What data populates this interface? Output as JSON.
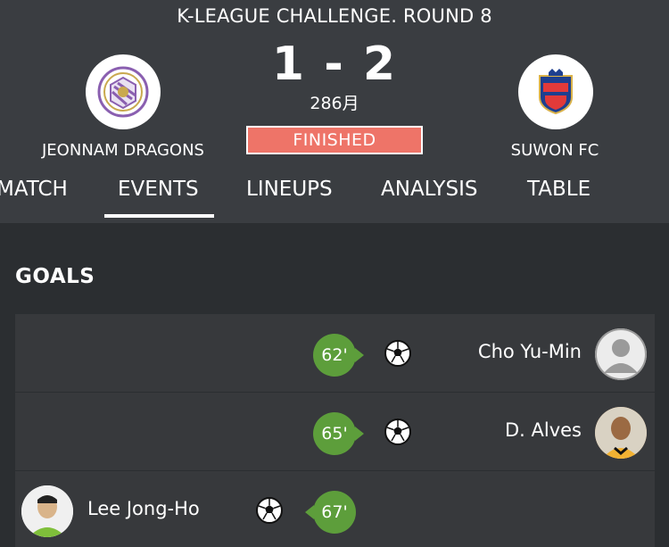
{
  "match": {
    "round_title": "K-LEAGUE CHALLENGE. ROUND 8",
    "score": "1 - 2",
    "score_sub": "286月",
    "status": "FINISHED"
  },
  "home_team": {
    "name": "JEONNAM DRAGONS",
    "logo_icon": "jeonnam-dragons-crest-icon"
  },
  "away_team": {
    "name": "SUWON FC",
    "logo_icon": "suwon-fc-crest-icon"
  },
  "tabs": [
    {
      "label": "MATCH"
    },
    {
      "label": "EVENTS",
      "active": true
    },
    {
      "label": "LINEUPS"
    },
    {
      "label": "ANALYSIS"
    },
    {
      "label": "TABLE"
    }
  ],
  "goals_section": {
    "title": "GOALS",
    "events": [
      {
        "minute": "62'",
        "player": "Cho Yu-Min",
        "side": "away",
        "icon": "soccer-ball-icon"
      },
      {
        "minute": "65'",
        "player": "D. Alves",
        "side": "away",
        "icon": "soccer-ball-icon"
      },
      {
        "minute": "67'",
        "player": "Lee Jong-Ho",
        "side": "home",
        "icon": "soccer-ball-icon"
      }
    ]
  },
  "colors": {
    "header_bg": "#3a3d41",
    "page_bg": "#2b2e31",
    "row_bg": "#37393c",
    "status_badge": "#ee7468",
    "minute_bubble": "#5d9e3b",
    "home_crest": "#8a5fb0",
    "away_crest": "#e23a3a"
  }
}
